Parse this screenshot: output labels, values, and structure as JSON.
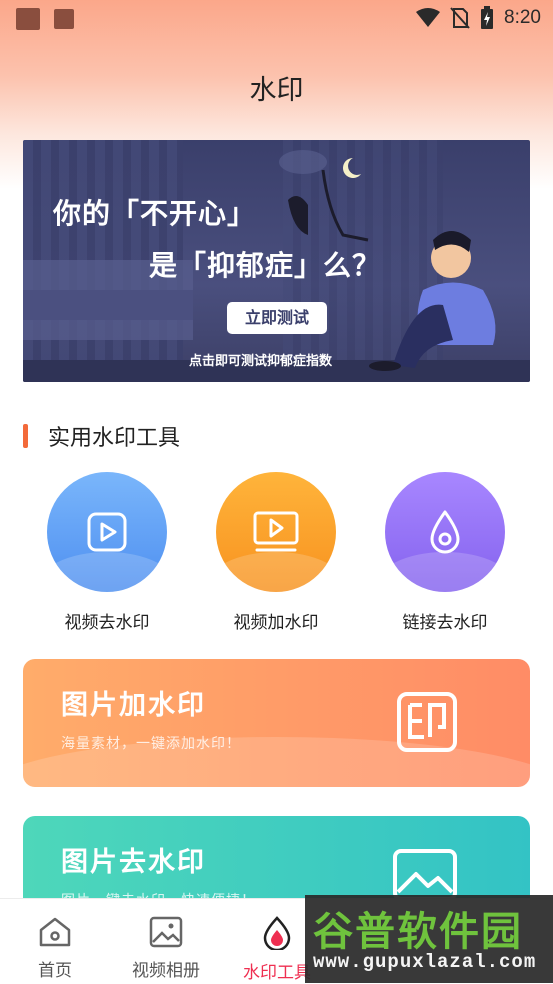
{
  "status_bar": {
    "time": "8:20",
    "icons": [
      "wifi-icon",
      "no-sim-icon",
      "battery-charging-icon"
    ]
  },
  "header": {
    "title": "水印"
  },
  "banner": {
    "line1": "你的「不开心」",
    "line2": "是「抑郁症」么？",
    "cta": "立即测试",
    "sub": "点击即可测试抑郁症指数"
  },
  "section": {
    "title": "实用水印工具"
  },
  "tools": [
    {
      "label": "视频去水印",
      "icon": "video-play-icon",
      "color": "#5a9af3"
    },
    {
      "label": "视频加水印",
      "icon": "video-screen-icon",
      "color": "#f99e27"
    },
    {
      "label": "链接去水印",
      "icon": "water-drop-icon",
      "color": "#9272f4"
    }
  ],
  "cards": [
    {
      "title": "图片加水印",
      "subtitle": "海量素材，一键添加水印！",
      "icon": "seal-stamp-icon",
      "color": "#ff9a68"
    },
    {
      "title": "图片去水印",
      "subtitle": "图片一键去水印，快速便捷！",
      "icon": "image-icon",
      "color": "#40cdbf"
    }
  ],
  "bottom_nav": [
    {
      "label": "首页",
      "icon": "home-icon",
      "active": false
    },
    {
      "label": "视频相册",
      "icon": "photo-album-icon",
      "active": false
    },
    {
      "label": "水印工具",
      "icon": "water-drop-icon",
      "active": true
    }
  ],
  "watermark": {
    "brand": "谷普软件园",
    "url": "www.gupuxlazal.com"
  },
  "colors": {
    "accent": "#ef2f51",
    "section_bar": "#f36a3a"
  }
}
